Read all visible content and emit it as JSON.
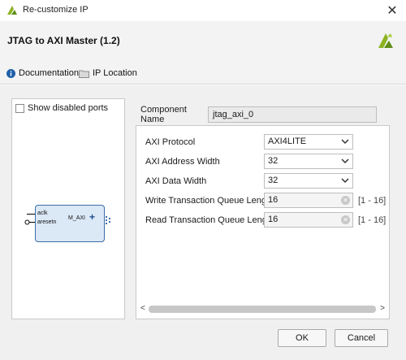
{
  "window": {
    "title": "Re-customize IP",
    "close_glyph": "✕"
  },
  "header": {
    "ip_title": "JTAG to AXI Master (1.2)",
    "logo_icon": "vivado-logo-icon"
  },
  "links": {
    "documentation": "Documentation",
    "ip_location": "IP Location"
  },
  "left_panel": {
    "show_disabled_ports": "Show disabled ports",
    "block": {
      "inputs": [
        "aclk",
        "aresetn"
      ],
      "output": "M_AXI",
      "plus": "+"
    }
  },
  "component": {
    "label": "Component Name",
    "value": "jtag_axi_0"
  },
  "params": [
    {
      "label": "AXI Protocol",
      "type": "select",
      "value": "AXI4LITE"
    },
    {
      "label": "AXI Address Width",
      "type": "select",
      "value": "32"
    },
    {
      "label": "AXI Data Width",
      "type": "select",
      "value": "32"
    },
    {
      "label": "Write Transaction Queue Length",
      "type": "text",
      "value": "16",
      "range": "[1 - 16]"
    },
    {
      "label": "Read Transaction Queue Length",
      "type": "text",
      "value": "16",
      "range": "[1 - 16]"
    }
  ],
  "scroll": {
    "left": "<",
    "right": ">"
  },
  "buttons": {
    "ok": "OK",
    "cancel": "Cancel"
  },
  "colors": {
    "logo_green": "#8cb422",
    "block_fill": "#dbe8f6",
    "block_border": "#3a6ea5",
    "info_blue": "#1f5fa8"
  }
}
